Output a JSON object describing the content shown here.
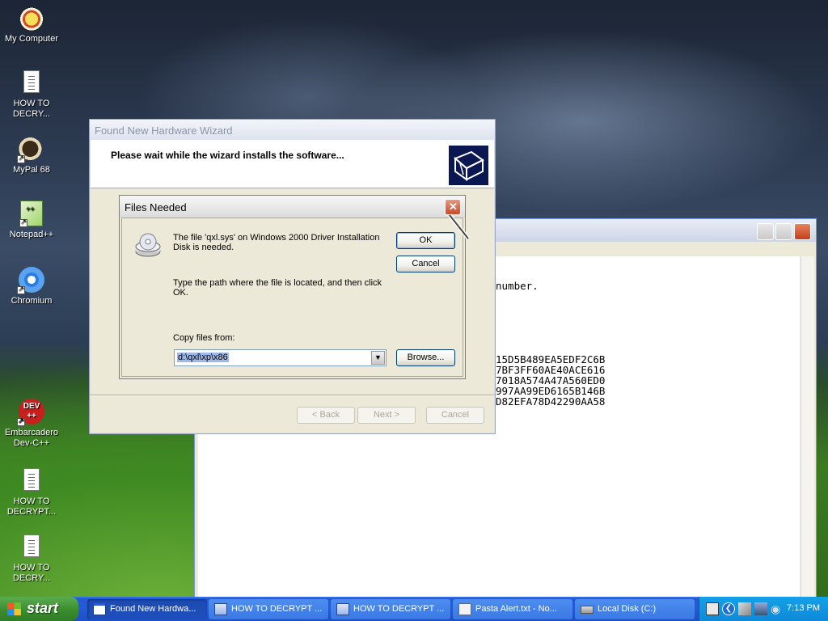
{
  "desktop": {
    "icons": [
      {
        "label": "My Computer"
      },
      {
        "label": "HOW TO DECRY..."
      },
      {
        "label": "MyPal 68"
      },
      {
        "label": "Notepad++"
      },
      {
        "label": "Chromium"
      },
      {
        "label": "Embarcadero Dev-C++"
      },
      {
        "label": "HOW TO DECRYPT..."
      },
      {
        "label": "HOW TO DECRY..."
      }
    ]
  },
  "notepad": {
    "lines": [
      "number.",
      "15D5B489EA5EDF2C6B",
      "7BF3FF60AE40ACE616",
      "7018A574A47A560ED0",
      "997AA99ED6165B146B",
      "D82EFA78D42290AA58"
    ]
  },
  "wizard": {
    "title": "Found New Hardware Wizard",
    "header_text": "Please wait while the wizard installs the software...",
    "buttons": {
      "back": "< Back",
      "next": "Next >",
      "cancel": "Cancel"
    }
  },
  "files_needed": {
    "title": "Files Needed",
    "message": "The file 'qxl.sys' on Windows 2000 Driver Installation Disk is needed.",
    "instruction": "Type the path where the file is located, and then click OK.",
    "copy_label": "Copy files from:",
    "path_value": "d:\\qxl\\xp\\x86",
    "ok": "OK",
    "cancel": "Cancel",
    "browse": "Browse..."
  },
  "taskbar": {
    "start": "start",
    "tasks": [
      {
        "label": "Found New Hardwa...",
        "icon": "window-icon",
        "active": true
      },
      {
        "label": "HOW TO DECRYPT ...",
        "icon": "word-icon"
      },
      {
        "label": "HOW TO DECRYPT ...",
        "icon": "word-icon"
      },
      {
        "label": "Pasta Alert.txt - No...",
        "icon": "notepad-icon"
      },
      {
        "label": "Local Disk (C:)",
        "icon": "disk-icon"
      }
    ],
    "clock": "7:13 PM"
  }
}
